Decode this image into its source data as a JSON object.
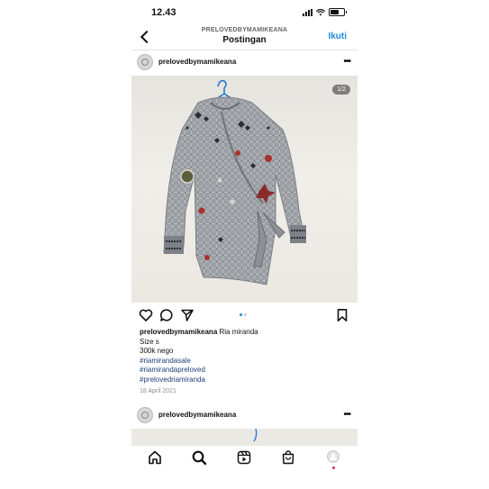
{
  "status": {
    "time": "12.43"
  },
  "header": {
    "account_label": "PRELOVEDBYMAMIKEANA",
    "title": "Postingan",
    "follow_label": "Ikuti"
  },
  "post": {
    "username": "prelovedbymamikeana",
    "image_counter": "1/2",
    "image_index": 1,
    "image_total": 2,
    "caption_username": "prelovedbymamikeana",
    "caption_text": "Ria miranda",
    "lines": [
      "Size s",
      "300k nego"
    ],
    "hashtags": [
      "#riamirandasale",
      "#riamirandapreloved",
      "#prelovedriamiranda"
    ],
    "date": "18 April 2021"
  },
  "next_post": {
    "username": "prelovedbymamikeana"
  },
  "icons": {
    "back": "chevron-left-icon",
    "more": "more-horizontal-icon",
    "like": "heart-icon",
    "comment": "comment-icon",
    "share": "send-icon",
    "save": "bookmark-icon",
    "home": "home-icon",
    "search": "search-icon",
    "reels": "reels-icon",
    "shop": "shop-bag-icon",
    "profile": "profile-avatar-icon"
  },
  "colors": {
    "accent": "#1a8dd9",
    "hashtag": "#1e3f7a",
    "notification": "#e0245e"
  }
}
